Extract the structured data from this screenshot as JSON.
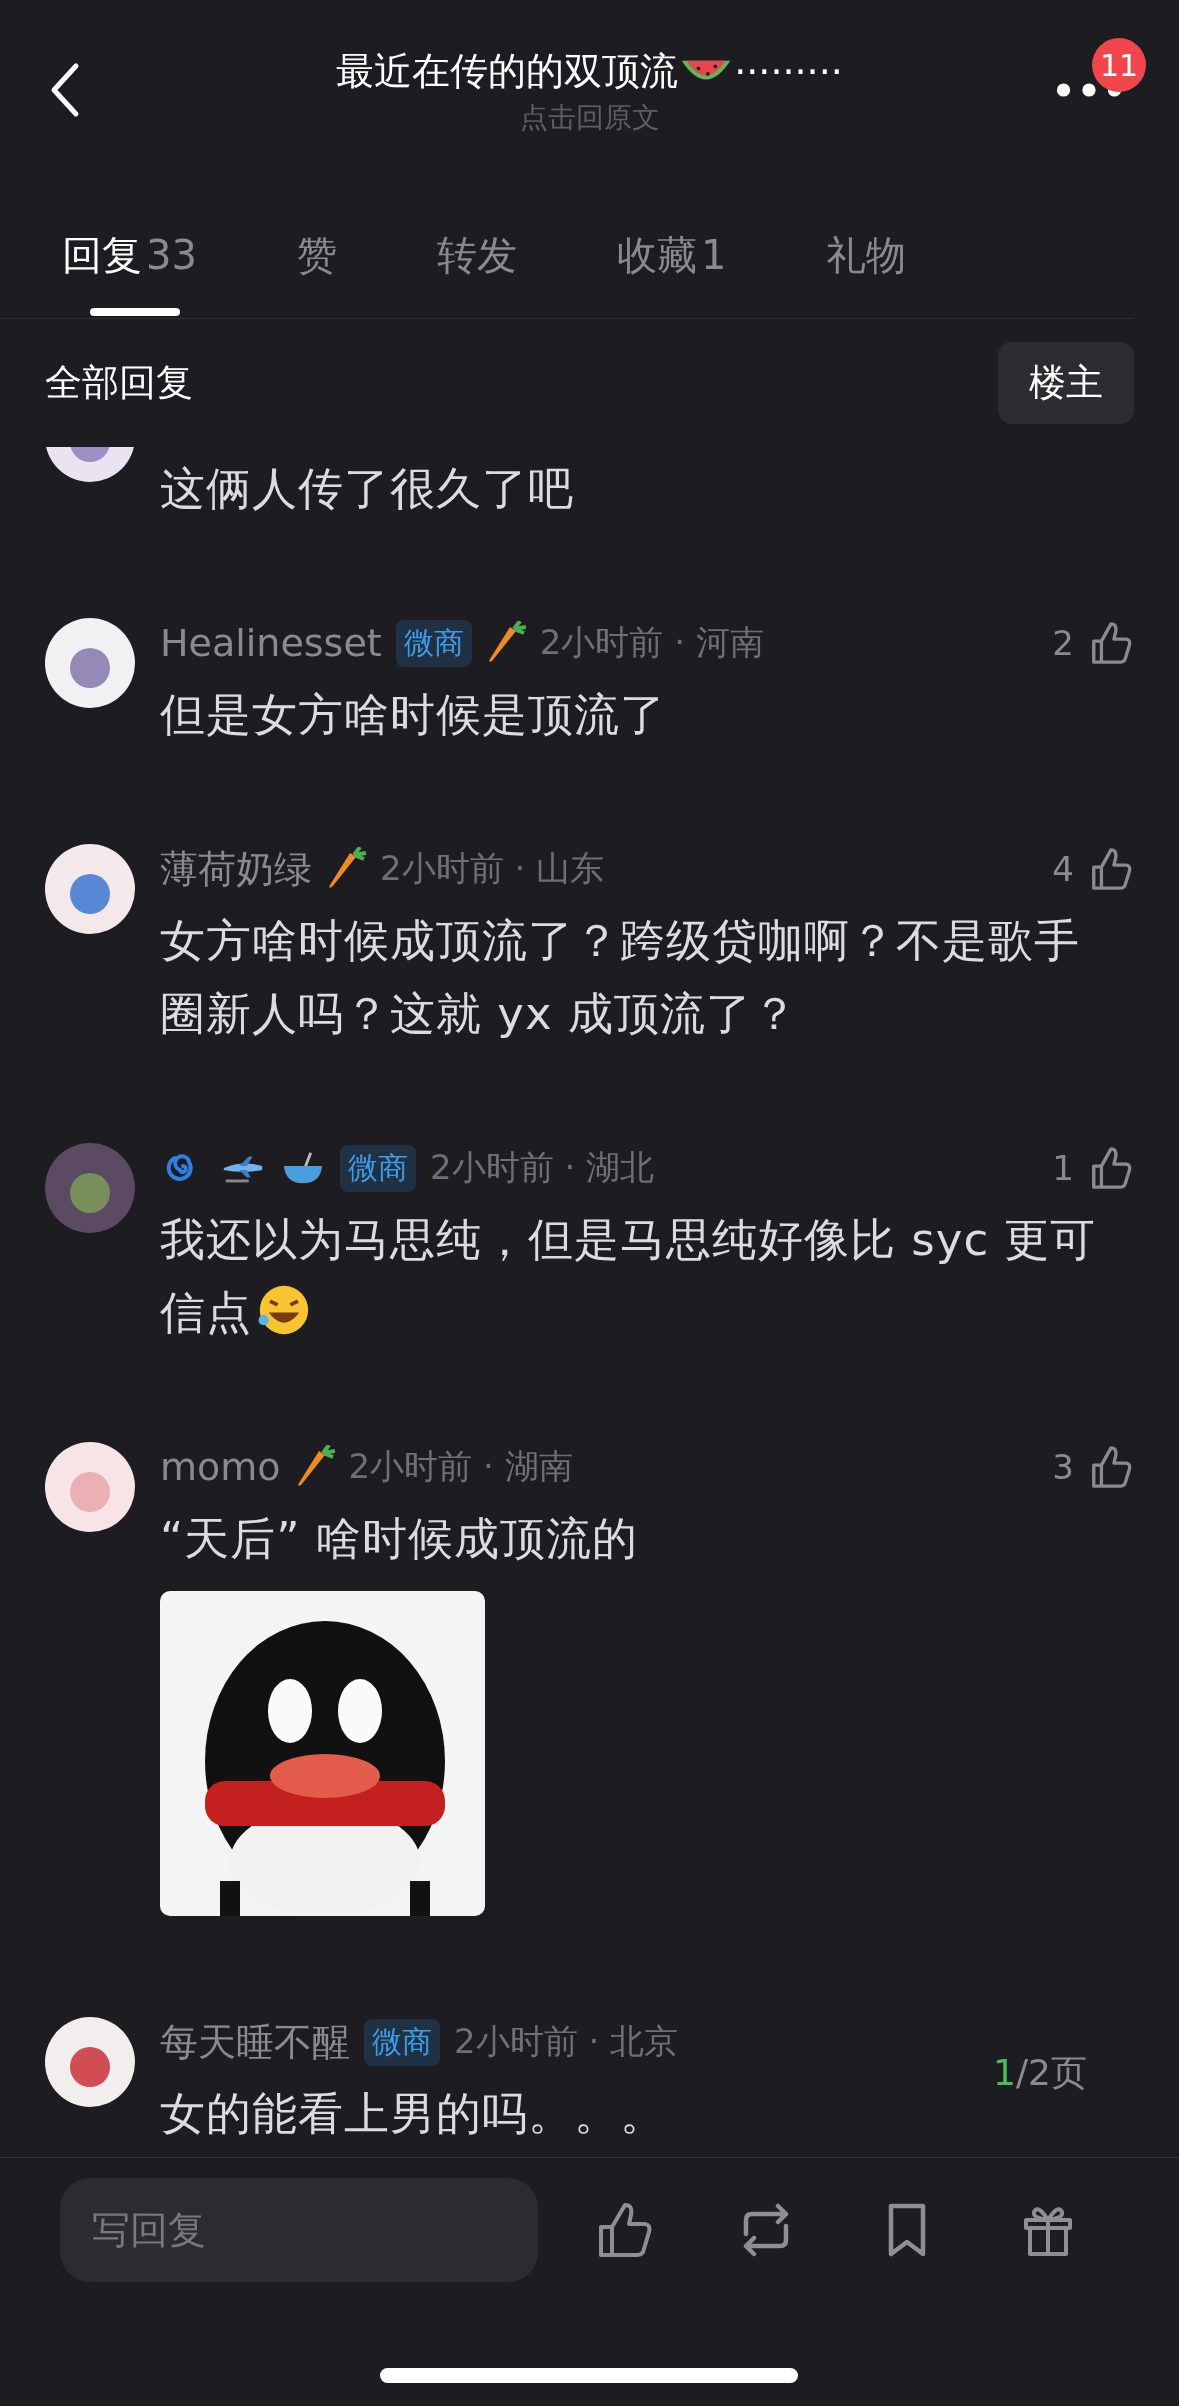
{
  "header": {
    "title": "最近在传的的双顶流",
    "title_tail": "·········",
    "subtitle": "点击回原文",
    "badge": "11"
  },
  "tabs": [
    {
      "label": "回复",
      "count": "33",
      "selected": true
    },
    {
      "label": "赞",
      "selected": false
    },
    {
      "label": "转发",
      "selected": false
    },
    {
      "label": "收藏",
      "count": "1",
      "selected": false
    },
    {
      "label": "礼物",
      "selected": false
    }
  ],
  "filter": {
    "label": "全部回复",
    "button": "楼主"
  },
  "comments": [
    {
      "partial": true,
      "text": "这俩人传了很久了吧"
    },
    {
      "name": "Healinesset",
      "tag": "微商",
      "carrot": true,
      "meta": "2小时前 · 河南",
      "likes": "2",
      "text": "但是女方啥时候是顶流了"
    },
    {
      "name": "薄荷奶绿",
      "carrot": true,
      "meta": "2小时前 · 山东",
      "likes": "4",
      "text": "女方啥时候成顶流了？跨级贷咖啊？不是歌手圈新人吗？这就 yx 成顶流了？"
    },
    {
      "name_icons": [
        {
          "kind": "spiral"
        },
        {
          "kind": "airplane"
        },
        {
          "kind": "bowl"
        }
      ],
      "tag": "微商",
      "carrot": false,
      "meta": "2小时前 · 湖北",
      "likes": "1",
      "text": "我还以为马思纯，但是马思纯好像比 syc 更可信点",
      "emoji": {
        "kind": "laughing"
      }
    },
    {
      "name": "momo",
      "carrot": true,
      "meta": "2小时前 · 湖南",
      "likes": "3",
      "text": "“天后” 啥时候成顶流的"
    },
    {
      "name": "每天睡不醒",
      "tag": "微商",
      "carrot": false,
      "meta": "2小时前 · 北京",
      "text": "女的能看上男的吗。。。"
    }
  ],
  "pager": {
    "current": "1",
    "rest": "/2页"
  },
  "composer": {
    "placeholder": "写回复"
  }
}
